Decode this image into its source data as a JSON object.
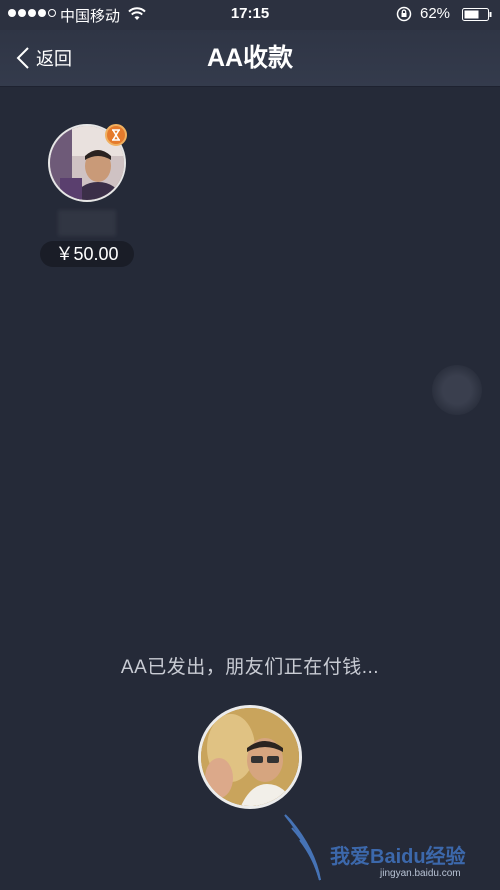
{
  "status_bar": {
    "carrier": "中国移动",
    "time": "17:15",
    "battery_percent": "62%",
    "signal_bars_filled": 4,
    "signal_bars_total": 5
  },
  "nav": {
    "back_label": "返回",
    "title": "AA收款"
  },
  "payers": [
    {
      "amount": "￥50.00",
      "pending_icon": "hourglass-icon"
    }
  ],
  "status_message": "AA已发出，朋友们正在付钱...",
  "watermark": {
    "text": "我爱Baidu经验",
    "url": "jingyan.baidu.com"
  },
  "colors": {
    "background": "#252a38",
    "nav_background": "#343b4c",
    "badge_orange": "#e57a2c",
    "amount_pill": "#1a1d27"
  }
}
